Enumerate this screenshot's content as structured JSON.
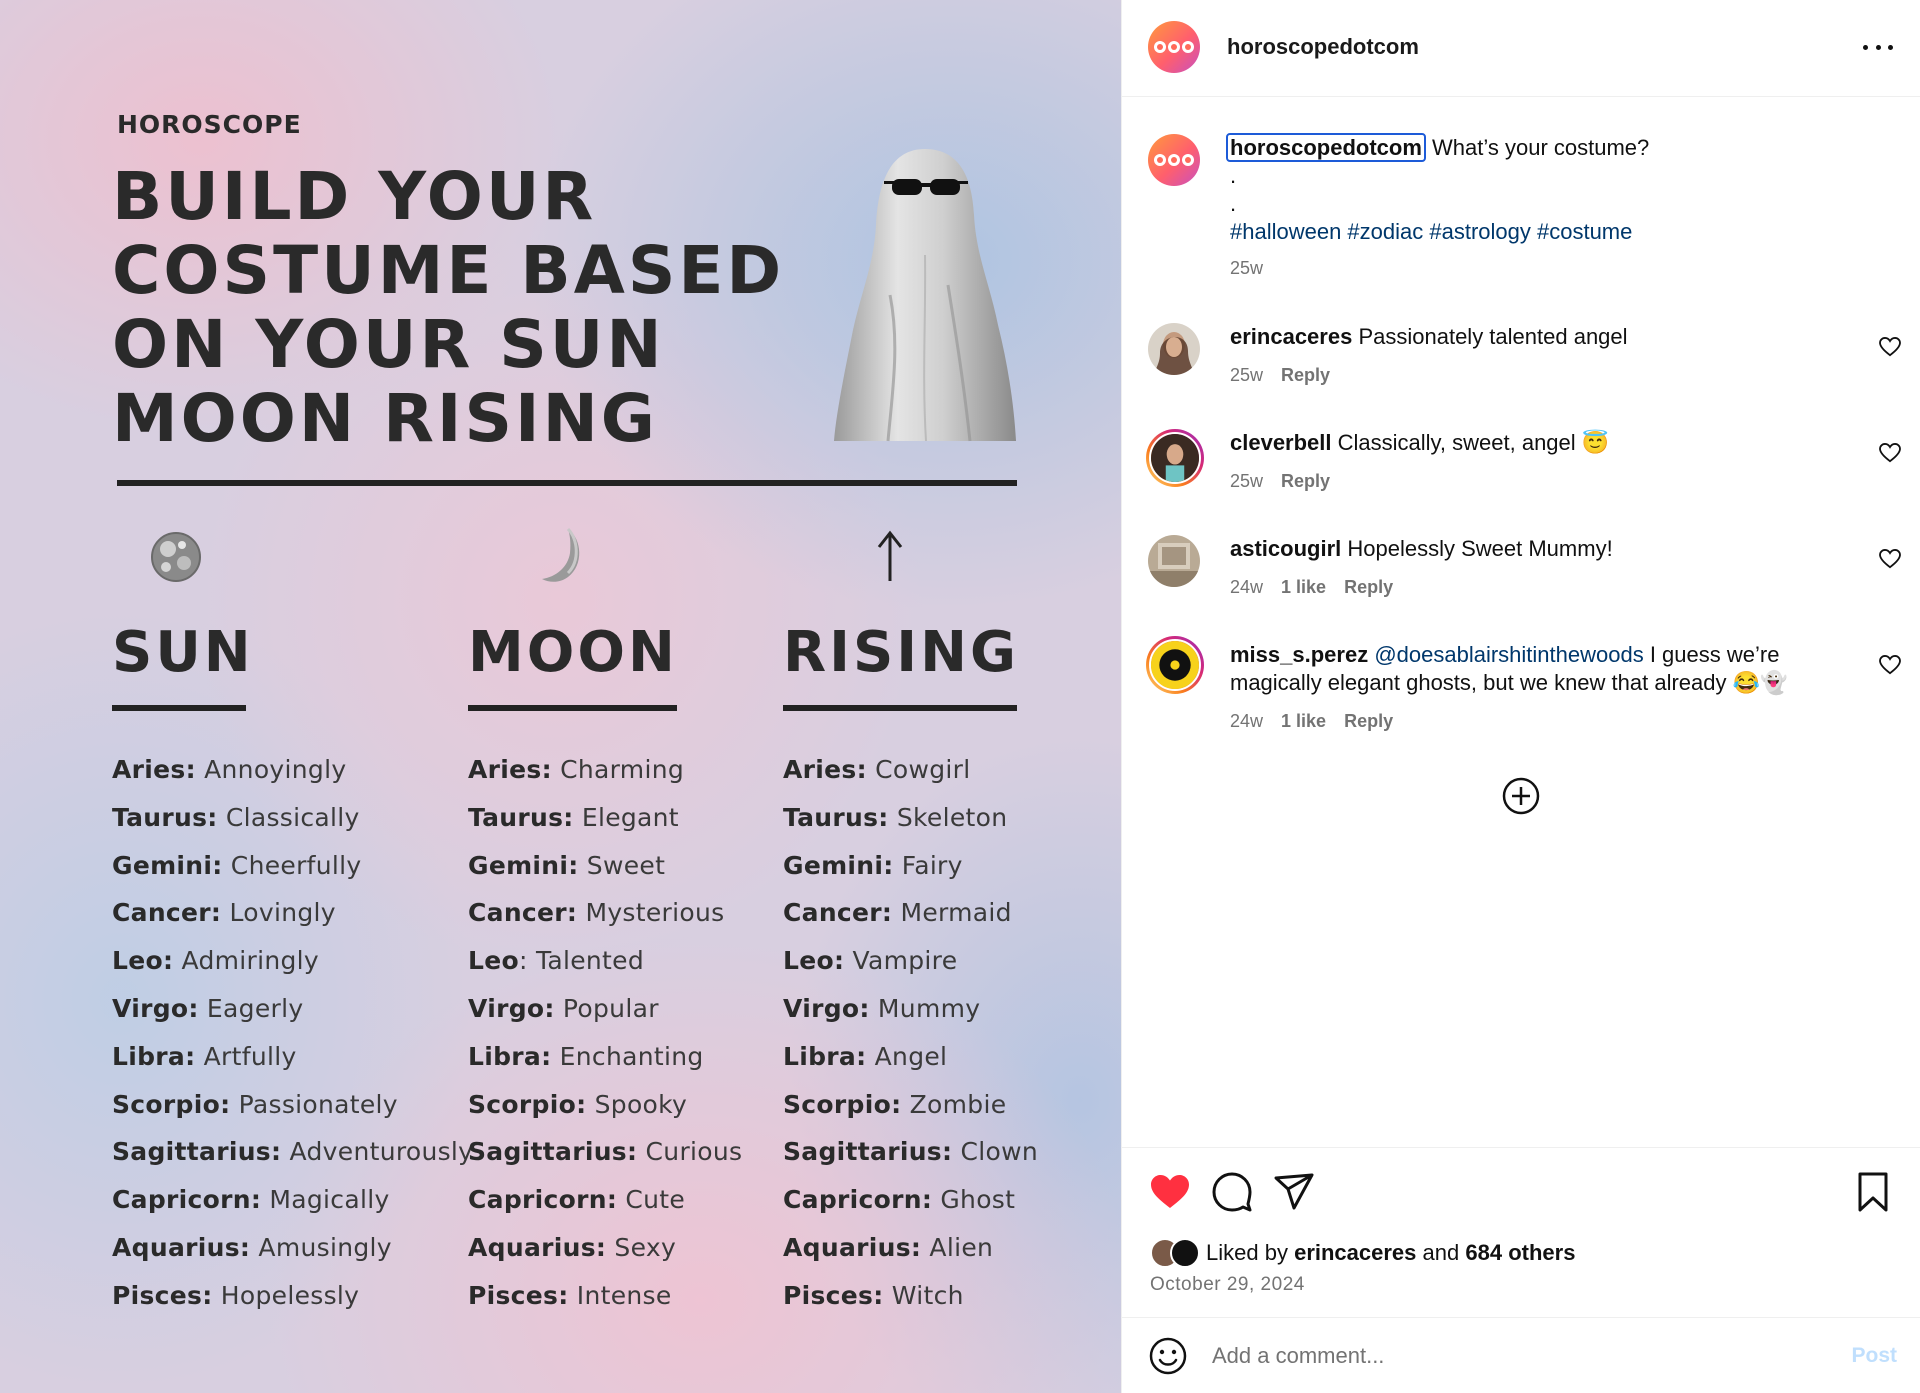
{
  "post_image": {
    "brand": "HOROSCOPE",
    "headline": [
      "BUILD YOUR",
      "COSTUME BASED",
      "ON YOUR SUN",
      "MOON RISING"
    ],
    "columns": [
      {
        "title": "SUN",
        "icon": "sun-icon",
        "items": [
          {
            "sign": "Aries:",
            "value": " Annoyingly"
          },
          {
            "sign": "Taurus:",
            "value": " Classically"
          },
          {
            "sign": "Gemini:",
            "value": " Cheerfully"
          },
          {
            "sign": "Cancer:",
            "value": " Lovingly"
          },
          {
            "sign": "Leo:",
            "value": " Admiringly"
          },
          {
            "sign": "Virgo:",
            "value": " Eagerly"
          },
          {
            "sign": "Libra:",
            "value": " Artfully"
          },
          {
            "sign": "Scorpio:",
            "value": " Passionately"
          },
          {
            "sign": "Sagittarius:",
            "value": " Adventurously"
          },
          {
            "sign": "Capricorn:",
            "value": " Magically"
          },
          {
            "sign": "Aquarius:",
            "value": " Amusingly"
          },
          {
            "sign": "Pisces:",
            "value": " Hopelessly"
          }
        ]
      },
      {
        "title": "MOON",
        "icon": "moon-icon",
        "items": [
          {
            "sign": "Aries:",
            "value": " Charming"
          },
          {
            "sign": "Taurus:",
            "value": " Elegant"
          },
          {
            "sign": "Gemini:",
            "value": " Sweet"
          },
          {
            "sign": "Cancer:",
            "value": " Mysterious"
          },
          {
            "sign": "Leo",
            "value": ": Talented"
          },
          {
            "sign": "Virgo:",
            "value": " Popular"
          },
          {
            "sign": "Libra:",
            "value": " Enchanting"
          },
          {
            "sign": "Scorpio:",
            "value": " Spooky"
          },
          {
            "sign": "Sagittarius:",
            "value": " Curious"
          },
          {
            "sign": "Capricorn:",
            "value": " Cute"
          },
          {
            "sign": "Aquarius:",
            "value": " Sexy"
          },
          {
            "sign": "Pisces:",
            "value": " Intense"
          }
        ]
      },
      {
        "title": "RISING",
        "icon": "arrow-up-icon",
        "items": [
          {
            "sign": "Aries:",
            "value": " Cowgirl"
          },
          {
            "sign": "Taurus:",
            "value": " Skeleton"
          },
          {
            "sign": "Gemini:",
            "value": " Fairy"
          },
          {
            "sign": "Cancer:",
            "value": " Mermaid"
          },
          {
            "sign": "Leo:",
            "value": " Vampire"
          },
          {
            "sign": "Virgo:",
            "value": " Mummy"
          },
          {
            "sign": "Libra:",
            "value": " Angel"
          },
          {
            "sign": "Scorpio:",
            "value": " Zombie"
          },
          {
            "sign": "Sagittarius:",
            "value": " Clown"
          },
          {
            "sign": "Capricorn:",
            "value": " Ghost"
          },
          {
            "sign": "Aquarius:",
            "value": " Alien"
          },
          {
            "sign": "Pisces:",
            "value": " Witch"
          }
        ]
      }
    ]
  },
  "header": {
    "username": "horoscopedotcom",
    "more_icon": "more-horizontal-icon"
  },
  "caption": {
    "username": "horoscopedotcom",
    "text": "What’s your costume?",
    "dot1": ".",
    "dot2": ".",
    "hashtags": "#halloween #zodiac #astrology #costume",
    "time": "25w"
  },
  "comments": [
    {
      "username": "erincaceres",
      "text": "Passionately talented angel",
      "time": "25w",
      "likes": "",
      "reply": "Reply"
    },
    {
      "username": "cleverbell",
      "text": "Classically, sweet, angel 😇",
      "time": "25w",
      "likes": "",
      "reply": "Reply"
    },
    {
      "username": "asticougirl",
      "text": "Hopelessly Sweet Mummy!",
      "time": "24w",
      "likes": "1 like",
      "reply": "Reply"
    },
    {
      "username": "miss_s.perez",
      "mention": "@doesablairshitinthewoods",
      "text": " I guess we’re magically elegant ghosts, but we knew that already 😂👻",
      "time": "24w",
      "likes": "1 like",
      "reply": "Reply"
    }
  ],
  "likes": {
    "prefix": "Liked by ",
    "user": "erincaceres",
    "middle": " and ",
    "others": "684 others"
  },
  "date": "October 29, 2024",
  "add_comment": {
    "placeholder": "Add a comment...",
    "post_label": "Post"
  },
  "colors": {
    "like_red": "#ff3040",
    "link_blue": "#00376b",
    "post_disabled": "#c0dffd"
  }
}
